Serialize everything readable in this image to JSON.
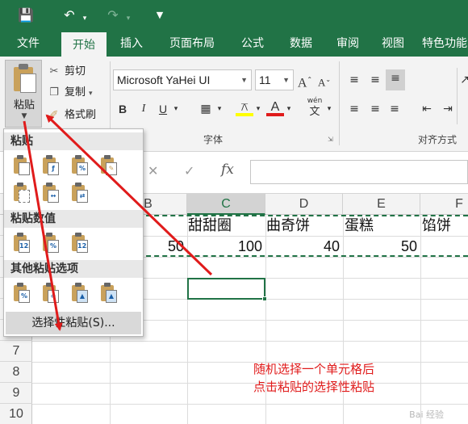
{
  "window": {
    "title_icons": [
      "save-icon",
      "undo-icon",
      "redo-icon",
      "customize-icon"
    ]
  },
  "tabs": [
    {
      "label": "文件",
      "active": false
    },
    {
      "label": "开始",
      "active": true
    },
    {
      "label": "插入",
      "active": false
    },
    {
      "label": "页面布局",
      "active": false
    },
    {
      "label": "公式",
      "active": false
    },
    {
      "label": "数据",
      "active": false
    },
    {
      "label": "审阅",
      "active": false
    },
    {
      "label": "视图",
      "active": false
    },
    {
      "label": "特色功能",
      "active": false
    }
  ],
  "ribbon": {
    "paste_label": "粘贴",
    "cut_label": "剪切",
    "copy_label": "复制",
    "format_painter_label": "格式刷",
    "font_name": "Microsoft YaHei UI",
    "font_size": "11",
    "font_group_label": "字体",
    "align_group_label": "对齐方式",
    "bold": "B",
    "italic": "I",
    "underline": "U",
    "wen": "wén",
    "wen_char": "文"
  },
  "formula_bar": {
    "fx_label": "fx"
  },
  "columns": [
    "B",
    "C",
    "D",
    "E",
    "F"
  ],
  "selected_column": "C",
  "rows": [
    "7",
    "8",
    "9",
    "10"
  ],
  "cells": {
    "row1": [
      "甜甜圈",
      "曲奇饼",
      "蛋糕",
      "馅饼"
    ],
    "row2": [
      "50",
      "100",
      "40",
      "50"
    ]
  },
  "paste_menu": {
    "section_paste": "粘贴",
    "section_paste_values": "粘贴数值",
    "section_other": "其他粘贴选项",
    "paste_special": "选择性粘贴(S)...",
    "icons_paste": [
      "paste-icon",
      "paste-formulas-icon",
      "paste-formulas-number-format-icon",
      "keep-source-formatting-icon",
      "no-borders-icon",
      "keep-column-widths-icon",
      "transpose-icon"
    ],
    "icons_values": [
      "paste-values-icon",
      "values-number-format-icon",
      "values-source-formatting-icon"
    ],
    "icons_other": [
      "paste-formatting-icon",
      "paste-link-icon",
      "paste-picture-icon",
      "linked-picture-icon"
    ]
  },
  "annotation": {
    "line1": "随机选择一个单元格后",
    "line2": "点击粘贴的选择性粘贴"
  },
  "watermark": "Bai 经验",
  "colors": {
    "excel_green": "#217346",
    "annotation_red": "#e01b1b"
  }
}
